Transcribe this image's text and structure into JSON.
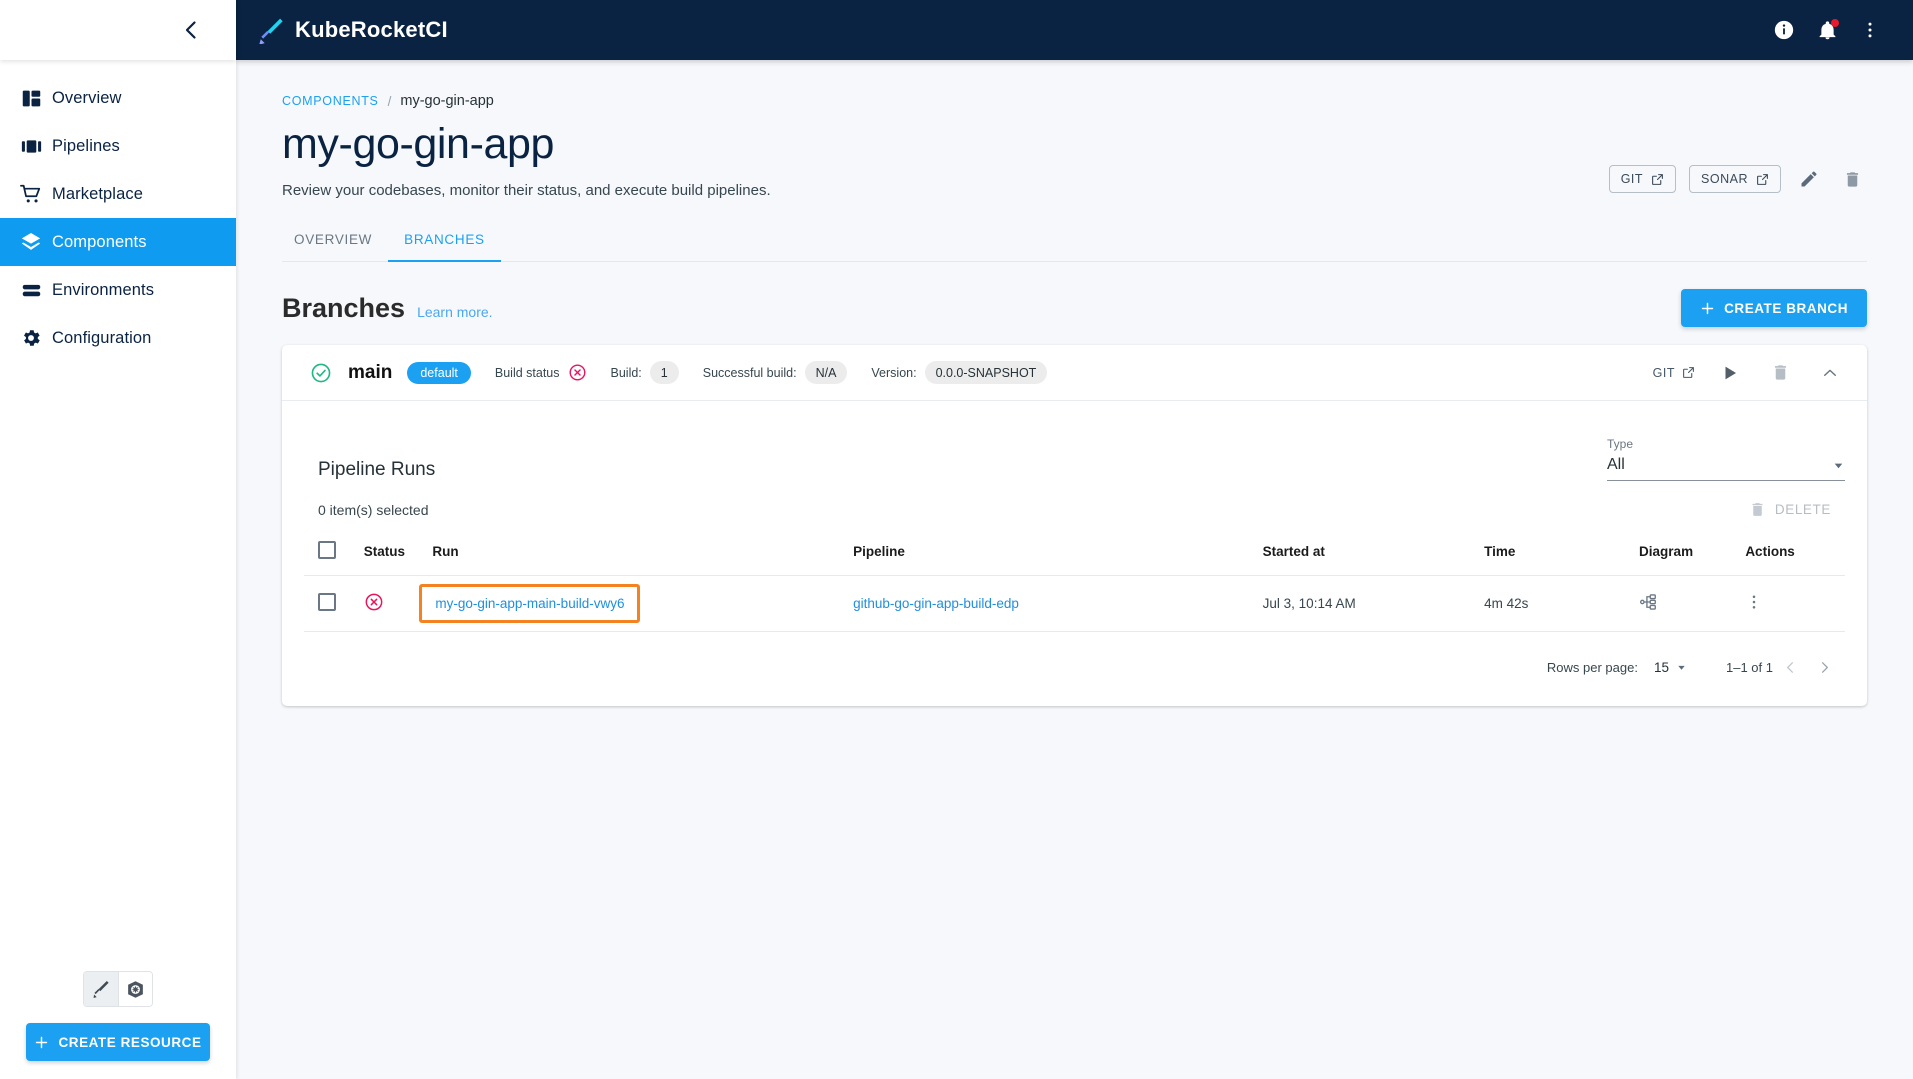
{
  "app": {
    "brand_name": "KubeRocketCI"
  },
  "topbar": {
    "info_icon": "info-icon",
    "notifications_icon": "bell-icon",
    "more_icon": "kebab-menu-icon"
  },
  "sidebar": {
    "collapse_icon": "chevron-left-icon",
    "items": [
      {
        "label": "Overview",
        "icon": "dashboard-icon",
        "active": false
      },
      {
        "label": "Pipelines",
        "icon": "pipelines-icon",
        "active": false
      },
      {
        "label": "Marketplace",
        "icon": "cart-icon",
        "active": false
      },
      {
        "label": "Components",
        "icon": "layers-icon",
        "active": true
      },
      {
        "label": "Environments",
        "icon": "stack-icon",
        "active": false
      },
      {
        "label": "Configuration",
        "icon": "gear-icon",
        "active": false
      }
    ],
    "view_toggles": [
      {
        "name": "krci-view-icon",
        "selected": true
      },
      {
        "name": "kubernetes-view-icon",
        "selected": false
      }
    ],
    "create_resource_label": "CREATE RESOURCE"
  },
  "breadcrumb": {
    "root": "COMPONENTS",
    "separator": "/",
    "current": "my-go-gin-app"
  },
  "page": {
    "title": "my-go-gin-app",
    "subtitle": "Review your codebases, monitor their status, and execute build pipelines."
  },
  "header_actions": {
    "git_label": "GIT",
    "sonar_label": "SONAR",
    "edit_icon": "pencil-icon",
    "delete_icon": "trash-icon"
  },
  "tabs": [
    {
      "label": "OVERVIEW",
      "active": false
    },
    {
      "label": "BRANCHES",
      "active": true
    }
  ],
  "branches_section": {
    "title": "Branches",
    "learn_more": "Learn more.",
    "create_button": "CREATE BRANCH"
  },
  "branch": {
    "status_icon": "check-circle-icon",
    "name": "main",
    "default_badge": "default",
    "build_status_label": "Build status",
    "build_status_icon": "error-circle-icon",
    "build_label": "Build:",
    "build_value": "1",
    "successful_build_label": "Successful build:",
    "successful_build_value": "N/A",
    "version_label": "Version:",
    "version_value": "0.0.0-SNAPSHOT",
    "git_label": "GIT",
    "run_icon": "play-icon",
    "delete_icon": "trash-icon",
    "collapse_icon": "chevron-up-icon"
  },
  "pipeline_runs": {
    "title": "Pipeline Runs",
    "type_filter": {
      "label": "Type",
      "value": "All",
      "options": [
        "All"
      ]
    },
    "selected_text": "0 item(s) selected",
    "delete_label": "DELETE",
    "columns": [
      "",
      "Status",
      "Run",
      "Pipeline",
      "Started at",
      "Time",
      "Diagram",
      "Actions"
    ],
    "rows": [
      {
        "status_icon": "error-circle-icon",
        "run": "my-go-gin-app-main-build-vwy6",
        "run_highlighted": true,
        "pipeline": "github-go-gin-app-build-edp",
        "started_at": "Jul 3, 10:14 AM",
        "time": "4m 42s",
        "diagram_icon": "diagram-icon",
        "actions_icon": "kebab-menu-icon"
      }
    ],
    "pagination": {
      "rows_per_page_label": "Rows per page:",
      "rows_per_page_value": "15",
      "range": "1–1 of 1",
      "prev_icon": "chevron-left-icon",
      "next_icon": "chevron-right-icon"
    }
  },
  "colors": {
    "brand_navy": "#0a2342",
    "accent_blue": "#1ca1f2",
    "success_green": "#21b883",
    "error_pink": "#e8145c",
    "highlight_orange": "#f58220"
  }
}
